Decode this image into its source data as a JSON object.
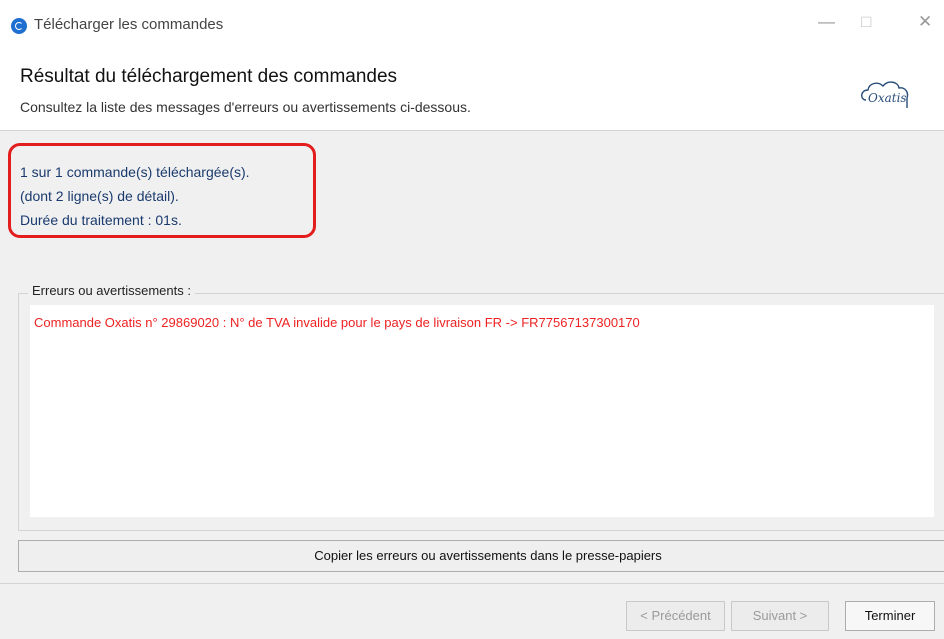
{
  "window": {
    "title": "Télécharger les commandes",
    "controls": {
      "minimize": "—",
      "maximize": "☐",
      "close": "✕"
    }
  },
  "header": {
    "title": "Résultat du téléchargement des commandes",
    "subtitle": "Consultez la liste des messages d'erreurs ou avertissements ci-dessous.",
    "logo_text": "Oxatis"
  },
  "summary": {
    "line1": "1 sur 1 commande(s) téléchargée(s).",
    "line2": "(dont 2 ligne(s) de détail).",
    "line3": "Durée du traitement : 01s."
  },
  "errors": {
    "label": "Erreurs ou avertissements :",
    "items": [
      "Commande Oxatis n° 29869020 : N° de TVA invalide pour le pays de livraison FR -> FR77567137300170"
    ]
  },
  "copy_button": "Copier les erreurs ou avertissements dans le presse-papiers",
  "footer": {
    "prev": "< Précédent",
    "next": "Suivant >",
    "finish": "Terminer"
  },
  "colors": {
    "highlight": "#e31d1d",
    "error_text": "#ee2222",
    "summary_text": "#1a3a6e",
    "logo": "#2a4d7a"
  }
}
